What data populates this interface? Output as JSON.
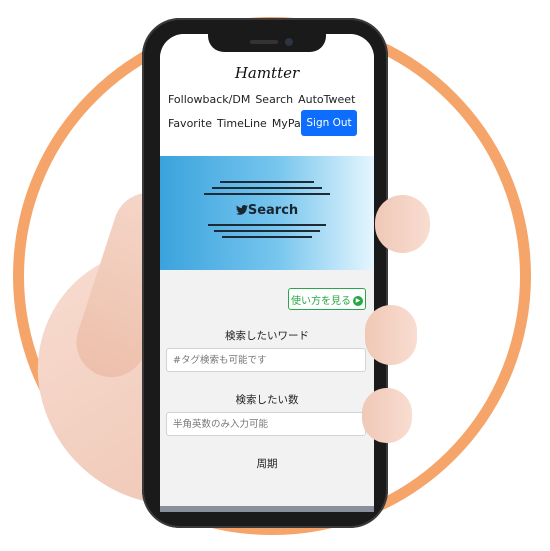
{
  "header": {
    "brand": "Hamtter",
    "nav_row1": [
      "Followback/DM",
      "Search",
      "AutoTweet"
    ],
    "nav_row2": [
      "Favorite",
      "TimeLine",
      "MyPage"
    ],
    "signout_label": "Sign Out"
  },
  "banner": {
    "title": "Search",
    "icon": "twitter-bird-icon"
  },
  "form": {
    "howto_label": "使い方を見る",
    "keyword_label": "検索したいワード",
    "keyword_placeholder": "#タグ検索も可能です",
    "count_label": "検索したい数",
    "count_placeholder": "半角英数のみ入力可能",
    "period_label": "周期"
  },
  "colors": {
    "ring": "#f5a46a",
    "primary_button": "#0d6efd",
    "success": "#27a745",
    "banner_start": "#3aa3dd",
    "banner_end": "#e6f6fe"
  }
}
